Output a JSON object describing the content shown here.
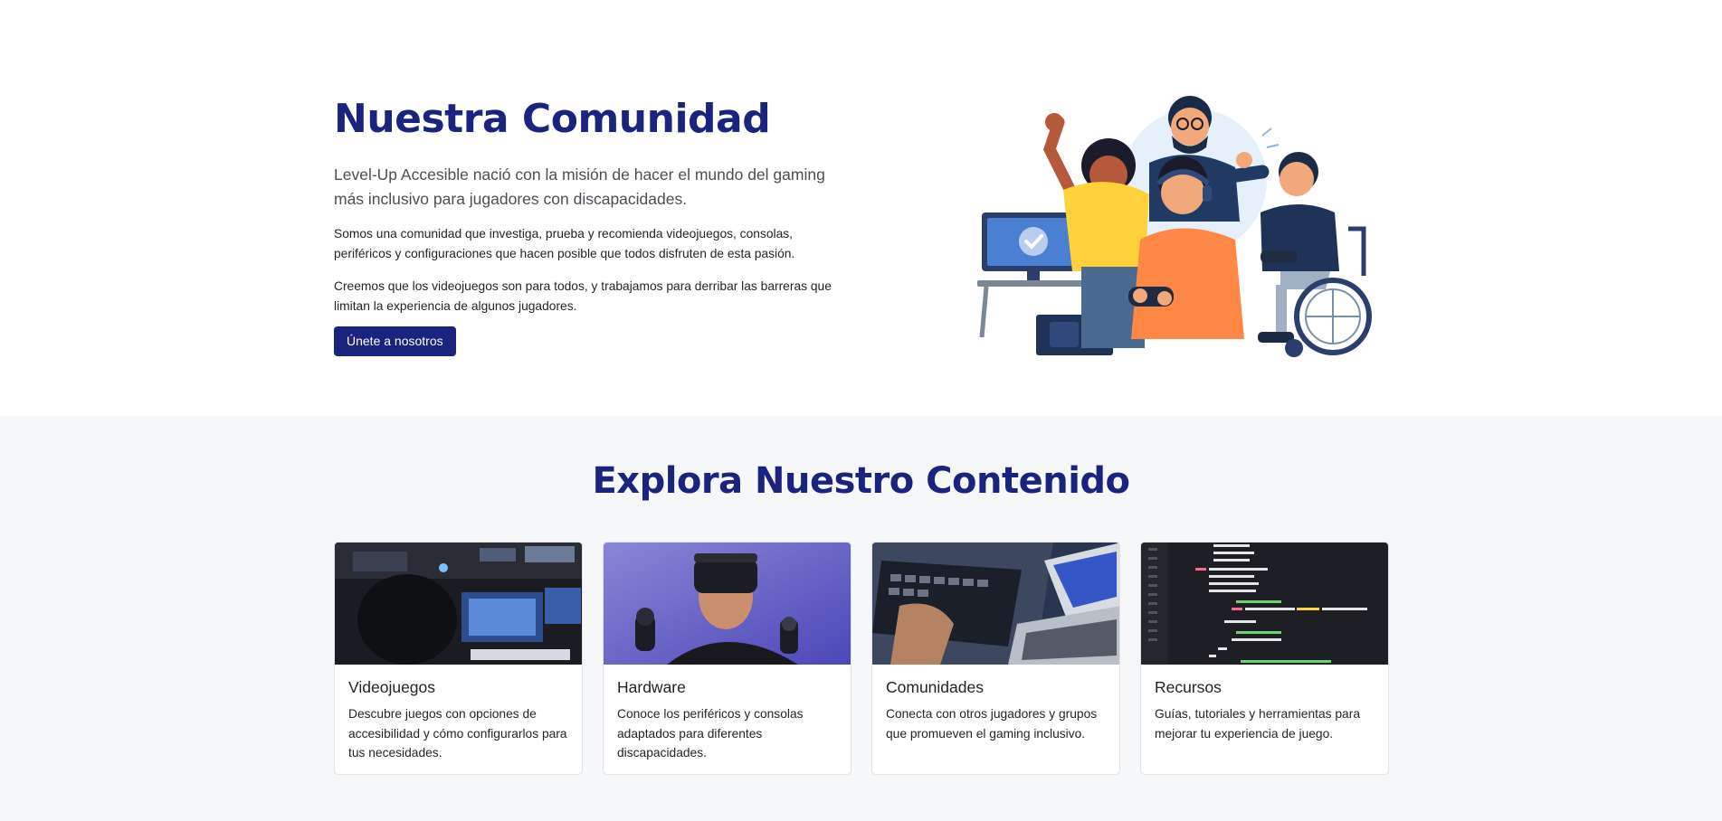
{
  "hero": {
    "title": "Nuestra Comunidad",
    "lead": "Level-Up Accesible nació con la misión de hacer el mundo del gaming más inclusivo para jugadores con discapacidades.",
    "paragraph1": "Somos una comunidad que investiga, prueba y recomienda videojuegos, consolas, periféricos y configuraciones que hacen posible que todos disfruten de esta pasión.",
    "paragraph2": "Creemos que los videojuegos son para todos, y trabajamos para derribar las barreras que limitan la experiencia de algunos jugadores.",
    "button_label": "Únete a nosotros",
    "illustration": "community-gamers-illustration"
  },
  "explore": {
    "title": "Explora Nuestro Contenido",
    "cards": [
      {
        "title": "Videojuegos",
        "text": "Descubre juegos con opciones de accesibilidad y cómo configurarlos para tus necesidades.",
        "image": "gaming-setup-photo"
      },
      {
        "title": "Hardware",
        "text": "Conoce los periféricos y consolas adaptados para diferentes discapacidades.",
        "image": "vr-headset-photo"
      },
      {
        "title": "Comunidades",
        "text": "Conecta con otros jugadores y grupos que promueven el gaming inclusivo.",
        "image": "laptop-typing-photo"
      },
      {
        "title": "Recursos",
        "text": "Guías, tutoriales y herramientas para mejorar tu experiencia de juego.",
        "image": "code-editor-photo"
      }
    ]
  },
  "colors": {
    "brand": "#1a237e",
    "section_bg": "#f6f7f9",
    "card_border": "#dfe2e6"
  }
}
